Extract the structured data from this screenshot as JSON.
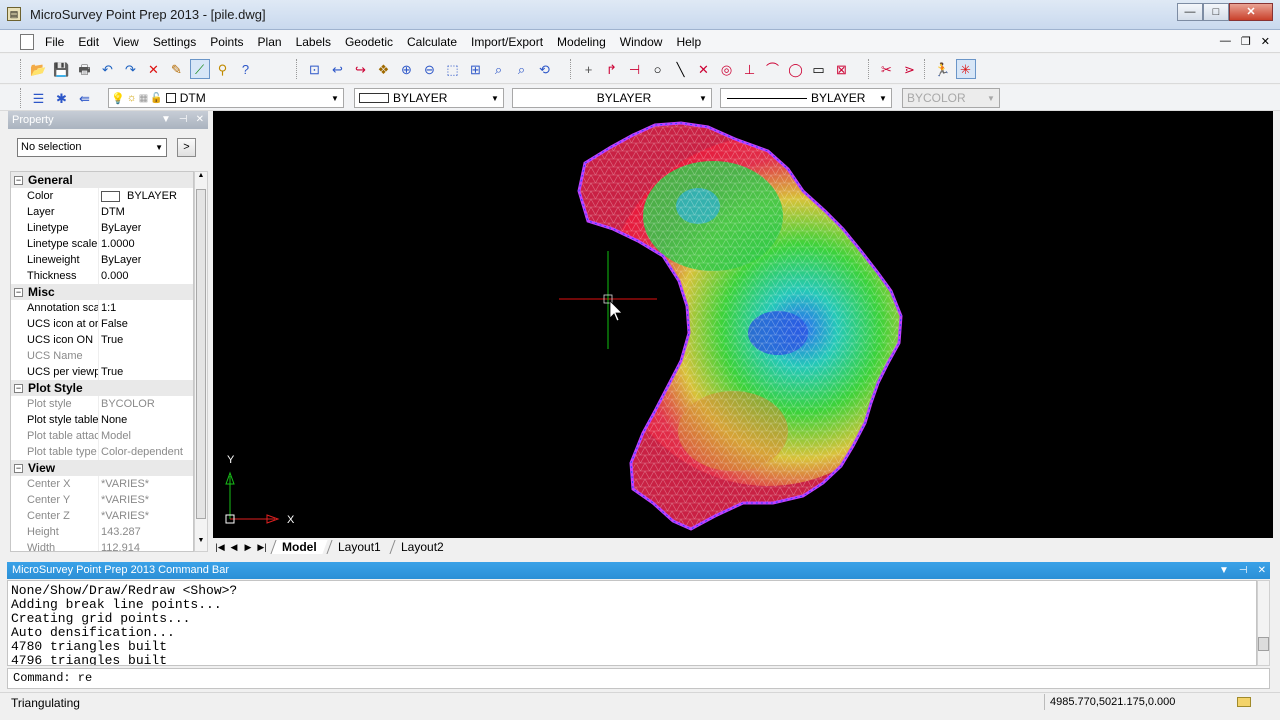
{
  "window": {
    "title": "MicroSurvey Point Prep 2013  - [pile.dwg]",
    "controls": {
      "minimize": "—",
      "maximize": "□",
      "close": "✕"
    }
  },
  "menu": {
    "items": [
      "File",
      "Edit",
      "View",
      "Settings",
      "Points",
      "Plan",
      "Labels",
      "Geodetic",
      "Calculate",
      "Import/Export",
      "Modeling",
      "Window",
      "Help"
    ],
    "mdi_controls": {
      "minimize": "—",
      "restore": "❐",
      "close": "✕"
    }
  },
  "toolbar_layers": {
    "layer": "DTM",
    "color": "BYLAYER",
    "linetype": "BYLAYER",
    "lineweight": "BYLAYER",
    "plotstyle": "BYCOLOR"
  },
  "property_panel": {
    "title": "Property",
    "selection": "No selection",
    "go_label": ">",
    "categories": [
      {
        "name": "General",
        "toggle": "−",
        "rows": [
          {
            "name": "Color",
            "value": "BYLAYER",
            "swatch": true,
            "dim": false
          },
          {
            "name": "Layer",
            "value": "DTM",
            "dim": false
          },
          {
            "name": "Linetype",
            "value": "ByLayer",
            "dim": false
          },
          {
            "name": "Linetype scale",
            "value": "1.0000",
            "dim": false
          },
          {
            "name": "Lineweight",
            "value": "ByLayer",
            "dim": false
          },
          {
            "name": "Thickness",
            "value": "0.000",
            "dim": false
          }
        ]
      },
      {
        "name": "Misc",
        "toggle": "−",
        "rows": [
          {
            "name": "Annotation scale",
            "value": "1:1",
            "dim": false
          },
          {
            "name": "UCS icon at origin",
            "value": "False",
            "dim": false
          },
          {
            "name": "UCS icon ON",
            "value": "True",
            "dim": false
          },
          {
            "name": "UCS Name",
            "value": "",
            "dim": true
          },
          {
            "name": "UCS per viewport",
            "value": "True",
            "dim": false
          }
        ]
      },
      {
        "name": "Plot Style",
        "toggle": "−",
        "rows": [
          {
            "name": "Plot style",
            "value": "BYCOLOR",
            "dim": true
          },
          {
            "name": "Plot style table",
            "value": "None",
            "dim": false
          },
          {
            "name": "Plot table attached to",
            "value": "Model",
            "dim": true
          },
          {
            "name": "Plot table type",
            "value": "Color-dependent",
            "dim": true
          }
        ]
      },
      {
        "name": "View",
        "toggle": "−",
        "rows": [
          {
            "name": "Center X",
            "value": "*VARIES*",
            "dim": true
          },
          {
            "name": "Center Y",
            "value": "*VARIES*",
            "dim": true
          },
          {
            "name": "Center Z",
            "value": "*VARIES*",
            "dim": true
          },
          {
            "name": "Height",
            "value": "143.287",
            "dim": true
          },
          {
            "name": "Width",
            "value": "112.914",
            "dim": true
          }
        ]
      }
    ]
  },
  "drawing": {
    "ucs_x_label": "X",
    "ucs_y_label": "Y"
  },
  "layout_tabs": {
    "nav": [
      "|◀",
      "◀",
      "▶",
      "▶|"
    ],
    "tabs": [
      {
        "label": "Model",
        "active": true
      },
      {
        "label": "Layout1",
        "active": false
      },
      {
        "label": "Layout2",
        "active": false
      }
    ]
  },
  "command_bar": {
    "title": "MicroSurvey Point Prep 2013 Command Bar",
    "output_lines": [
      "None/Show/Draw/Redraw <Show>?",
      "Adding break line points...",
      "Creating grid points...",
      "Auto densification...",
      "4780 triangles built",
      "4796 triangles built"
    ],
    "input": "Command: re"
  },
  "status": {
    "text": "Triangulating",
    "coordinates": "4985.770,5021.175,0.000"
  }
}
